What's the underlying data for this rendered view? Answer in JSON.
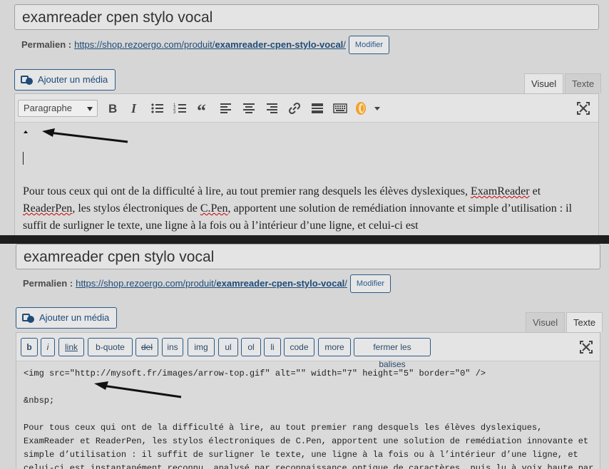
{
  "top": {
    "title": "examreader cpen stylo vocal",
    "permalink_label": "Permalien :",
    "permalink_base": "https://shop.rezoergo.com/produit/",
    "permalink_slug": "examreader-cpen-stylo-vocal",
    "permalink_end": "/",
    "edit_label": "Modifier",
    "media_label": "Ajouter un média",
    "tabs": [
      "Visuel",
      "Texte"
    ],
    "active_tab": "Visuel",
    "format_select": "Paragraphe",
    "paragraph": {
      "part1": "Pour tous ceux qui ont de la difficulté à lire, au tout premier rang desquels les élèves dyslexiques, ",
      "w1": "ExamReader",
      "part2": " et ",
      "w2": "ReaderPen",
      "part3": ", les stylos électroniques de ",
      "w3": "C.Pen",
      "part4": ", apportent une solution de remédiation innovante et simple d’utilisation : il suffit de surligner le texte, une ligne à la fois ou à l’intérieur d’une ligne, et celui-ci est"
    }
  },
  "bottom": {
    "title": "examreader cpen stylo vocal",
    "permalink_label": "Permalien :",
    "permalink_base": "https://shop.rezoergo.com/produit/",
    "permalink_slug": "examreader-cpen-stylo-vocal",
    "permalink_end": "/",
    "edit_label": "Modifier",
    "media_label": "Ajouter un média",
    "tabs": [
      "Visuel",
      "Texte"
    ],
    "active_tab": "Texte",
    "quicktags": [
      "b",
      "i",
      "link",
      "b-quote",
      "del",
      "ins",
      "img",
      "ul",
      "ol",
      "li",
      "code",
      "more",
      "fermer les balises"
    ],
    "code_lines": {
      "l1": "<img src=\"http://mysoft.fr/images/arrow-top.gif\" alt=\"\" width=\"7\" height=\"5\" border=\"0\" />",
      "l2": "&nbsp;",
      "l3": "Pour tous ceux qui ont de la difficulté à lire, au tout premier rang desquels les élèves dyslexiques,",
      "l4": "ExamReader et ReaderPen, les stylos électroniques de C.Pen, apportent une solution de remédiation innovante et",
      "l5": "simple d’utilisation : il suffit de surligner le texte, une ligne à la fois ou à l’intérieur d’une ligne, et",
      "l6": "celui-ci est instantanément reconnu, analysé par reconnaissance optique de caractères, puis lu à voix haute par"
    }
  },
  "colors": {
    "accent": "#2a5a8a",
    "link": "#1e4b7a",
    "divider": "#1e1e1e",
    "background": "#d6d6d6"
  },
  "icons": [
    "media-icon",
    "bold-icon",
    "italic-icon",
    "bullet-list-icon",
    "numbered-list-icon",
    "blockquote-icon",
    "align-left-icon",
    "align-center-icon",
    "align-right-icon",
    "link-icon",
    "read-more-icon",
    "toolbar-toggle-icon",
    "plugin-icon",
    "fullscreen-icon",
    "arrow-annotation"
  ]
}
